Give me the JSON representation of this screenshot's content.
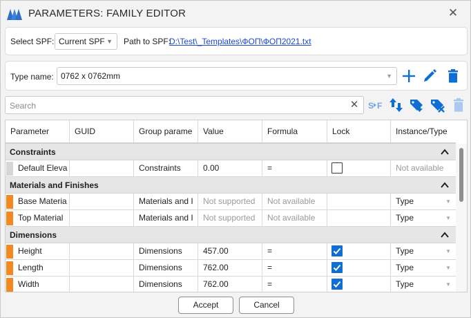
{
  "window": {
    "title": "PARAMETERS: FAMILY EDITOR"
  },
  "spf": {
    "select_label": "Select SPF:",
    "selected": "Current SPF",
    "path_label": "Path to SPF:",
    "path_value": "D:\\Test\\_Templates\\ФОП\\ФОП2021.txt"
  },
  "type_panel": {
    "label": "Type name:",
    "value": "0762 x 0762mm"
  },
  "search": {
    "placeholder": "Search"
  },
  "toolbar_icons": [
    "add-icon",
    "edit-icon",
    "delete-icon",
    "spf-icon",
    "sort-icon",
    "download-tag-icon",
    "remove-tag-icon",
    "trash-disabled-icon"
  ],
  "colors": {
    "accent": "#0e6ed1",
    "orange_flag": "#f5891f",
    "link": "#1a47d6"
  },
  "table": {
    "columns": [
      "Parameter",
      "GUID",
      "Group parame",
      "Value",
      "Formula",
      "Lock",
      "Instance/Type"
    ],
    "groups": [
      {
        "title": "Constraints",
        "rows": [
          {
            "flag": "gray",
            "parameter": "Default Eleva",
            "guid": "",
            "group": "Constraints",
            "value": "0.00",
            "value_dim": false,
            "formula": "=",
            "formula_dim": false,
            "lock": "unchecked",
            "instance": "Not available",
            "instance_dim": true,
            "instance_combo": false
          }
        ]
      },
      {
        "title": "Materials and Finishes",
        "rows": [
          {
            "flag": "orange",
            "parameter": "Base Materia",
            "guid": "",
            "group": "Materials and I",
            "value": "Not supported",
            "value_dim": true,
            "formula": "Not available",
            "formula_dim": true,
            "lock": "none",
            "instance": "Type",
            "instance_dim": false,
            "instance_combo": true
          },
          {
            "flag": "orange",
            "parameter": "Top Material",
            "guid": "",
            "group": "Materials and I",
            "value": "Not supported",
            "value_dim": true,
            "formula": "Not available",
            "formula_dim": true,
            "lock": "none",
            "instance": "Type",
            "instance_dim": false,
            "instance_combo": true
          }
        ]
      },
      {
        "title": "Dimensions",
        "rows": [
          {
            "flag": "orange",
            "parameter": "Height",
            "guid": "",
            "group": "Dimensions",
            "value": "457.00",
            "value_dim": false,
            "formula": "=",
            "formula_dim": false,
            "lock": "checked",
            "instance": "Type",
            "instance_dim": false,
            "instance_combo": true
          },
          {
            "flag": "orange",
            "parameter": "Length",
            "guid": "",
            "group": "Dimensions",
            "value": "762.00",
            "value_dim": false,
            "formula": "=",
            "formula_dim": false,
            "lock": "checked",
            "instance": "Type",
            "instance_dim": false,
            "instance_combo": true
          },
          {
            "flag": "orange",
            "parameter": "Width",
            "guid": "",
            "group": "Dimensions",
            "value": "762.00",
            "value_dim": false,
            "formula": "=",
            "formula_dim": false,
            "lock": "checked",
            "instance": "Type",
            "instance_dim": false,
            "instance_combo": true
          }
        ]
      }
    ]
  },
  "footer": {
    "accept": "Accept",
    "cancel": "Cancel"
  }
}
